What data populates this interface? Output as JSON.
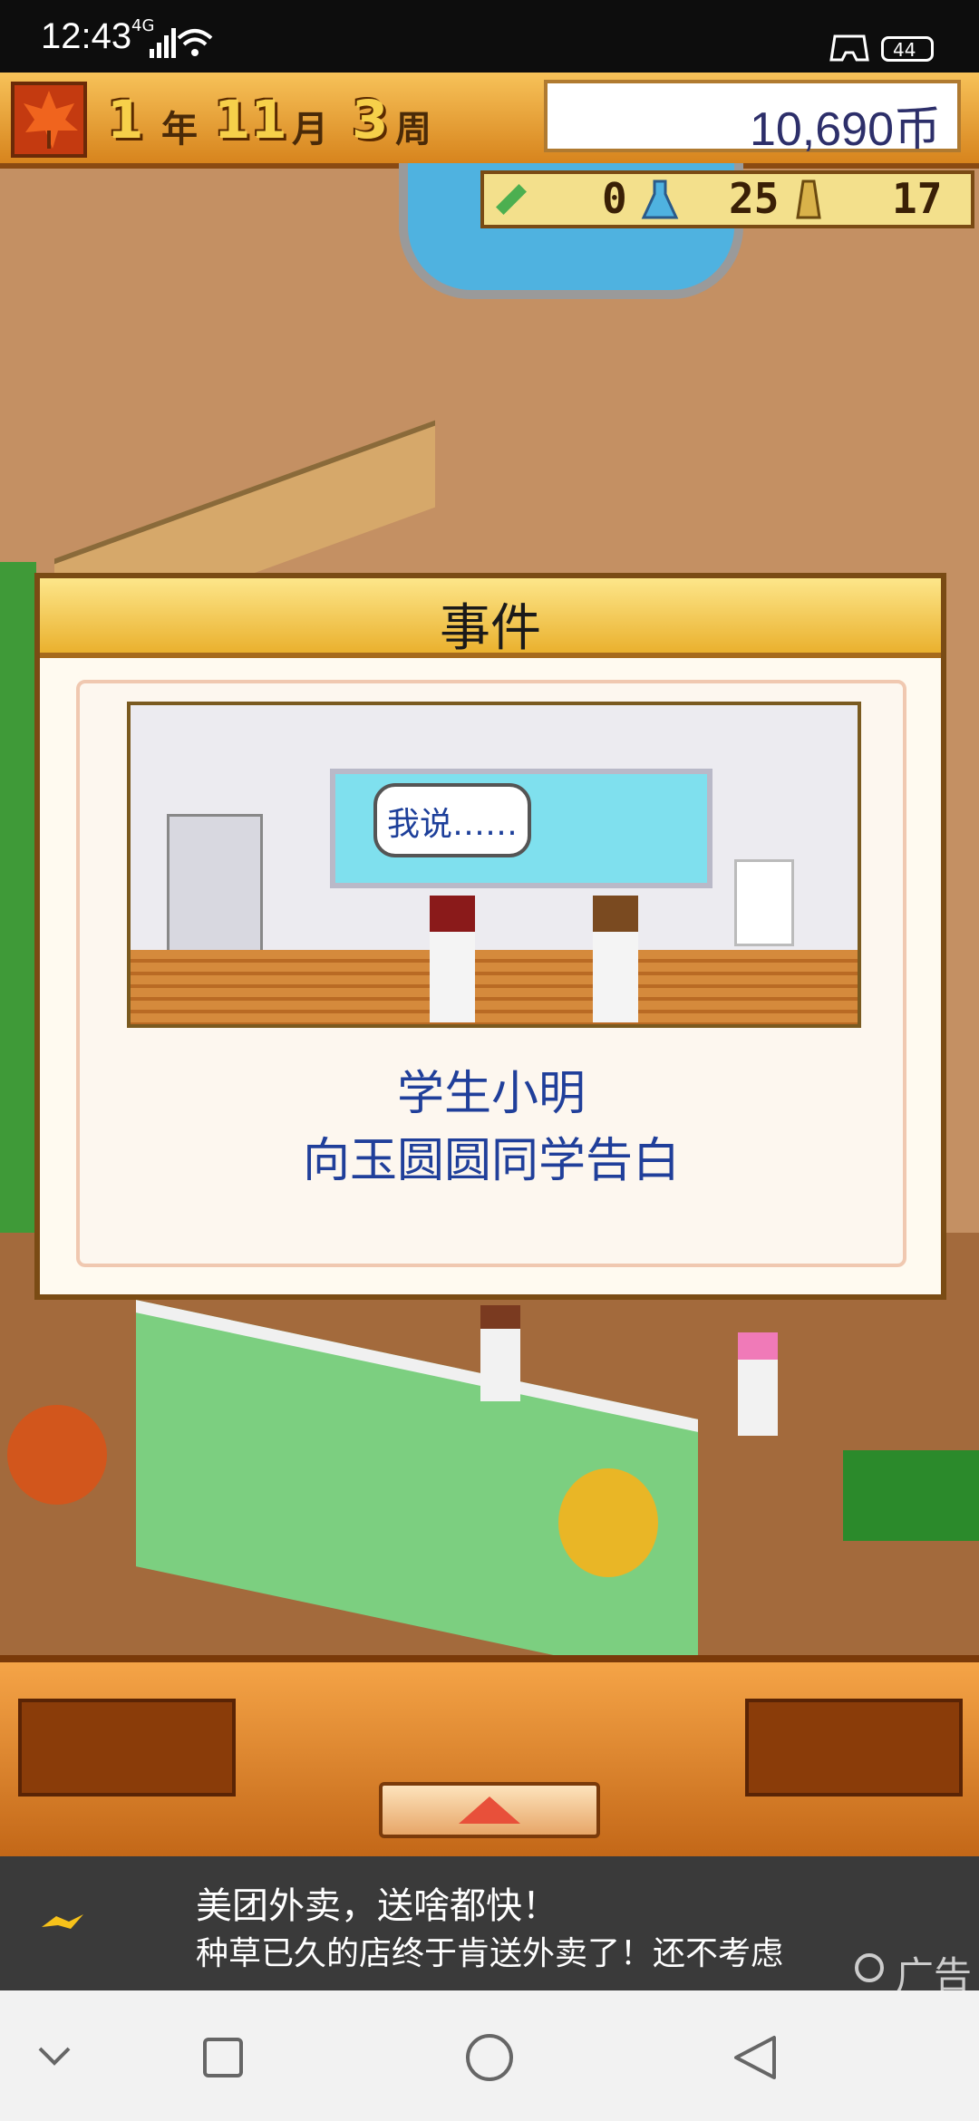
{
  "status_bar": {
    "time": "12:43",
    "network": "4G",
    "battery": "44"
  },
  "top_bar": {
    "year_num": "1",
    "year_unit": "年",
    "month_num": "11",
    "month_unit": "月",
    "week_num": "3",
    "week_unit": "周",
    "money": "10,690币"
  },
  "resources": {
    "research": "0",
    "potion": "25",
    "tower": "17"
  },
  "event": {
    "title": "事件",
    "speech": "我说……",
    "line1": "学生小明",
    "line2": "向玉圆圆同学告白"
  },
  "ad": {
    "line1": "美团外卖，送啥都快！",
    "line2": "种草已久的店终于肯送外卖了！还不考虑",
    "tag": "广告"
  },
  "colors": {
    "accent": "#eab12e",
    "text_blue": "#203f9a",
    "bg_ground": "#c49063"
  }
}
